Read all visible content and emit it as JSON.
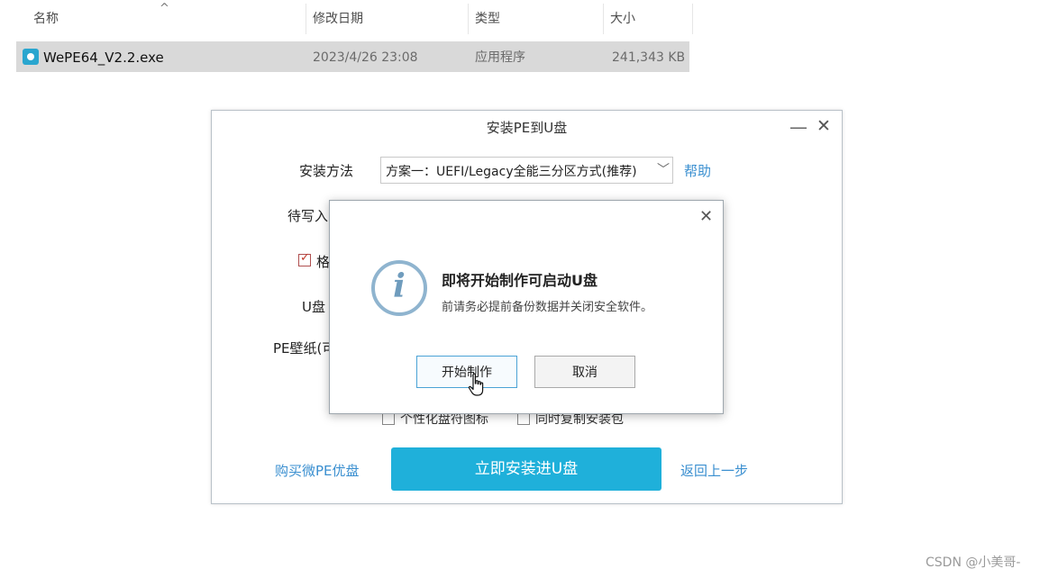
{
  "explorer": {
    "columns": {
      "name": "名称",
      "modified": "修改日期",
      "type": "类型",
      "size": "大小"
    },
    "file": {
      "name": "WePE64_V2.2.exe",
      "modified": "2023/4/26 23:08",
      "type": "应用程序",
      "size": "241,343 KB",
      "icon": "installer-disc-icon"
    }
  },
  "installer": {
    "title": "安装PE到U盘",
    "install_method_label": "安装方法",
    "install_method_value": "方案一：UEFI/Legacy全能三分区方式(推荐)",
    "help_link": "帮助",
    "target_label_partial": "待写入",
    "format_checkbox_partial": "格",
    "format_checked": true,
    "udisk_label_partial": "U盘",
    "wallpaper_label_partial": "PE壁纸(可",
    "personalize_icon_label": "个性化盘符图标",
    "copy_package_label": "同时复制安装包",
    "buy_link": "购买微PE优盘",
    "install_button": "立即安装进U盘",
    "back_link": "返回上一步",
    "accent_color": "#1fb0da"
  },
  "dialog": {
    "title": "即将开始制作可启动U盘",
    "message": "前请务必提前备份数据并关闭安全软件。",
    "ok_button": "开始制作",
    "cancel_button": "取消",
    "icon": "info-icon"
  },
  "watermark": "CSDN @小美哥-"
}
